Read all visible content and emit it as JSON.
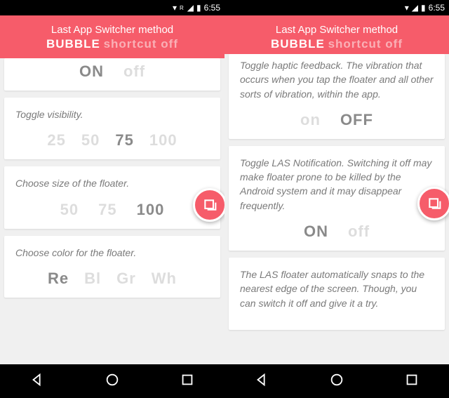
{
  "status": {
    "time": "6:55",
    "r": "R"
  },
  "header": {
    "title": "Last App Switcher method",
    "bubble": "BUBBLE",
    "shortcut": "shortcut off"
  },
  "p1": {
    "onoff": {
      "on": "ON",
      "off": "off"
    },
    "visibility": {
      "desc": "Toggle visibility.",
      "o1": "25",
      "o2": "50",
      "o3": "75",
      "o4": "100"
    },
    "size": {
      "desc": "Choose size of the floater.",
      "o1": "50",
      "o2": "75",
      "o3": "100"
    },
    "color": {
      "desc": "Choose color for the floater.",
      "o1": "Re",
      "o2": "Bl",
      "o3": "Gr",
      "o4": "Wh"
    }
  },
  "p2": {
    "haptic": {
      "desc": "Toggle haptic feedback. The vibration that occurs when you tap the floater and all other sorts of vibration, within the app.",
      "on": "on",
      "off": "OFF"
    },
    "notif": {
      "desc": "Toggle LAS Notification. Switching it off may make floater prone to be killed by the Android system and it may disappear frequently.",
      "on": "ON",
      "off": "off"
    },
    "snap": {
      "desc": "The LAS floater automatically snaps to the nearest edge of the screen. Though, you can switch it off and give it a try."
    }
  }
}
